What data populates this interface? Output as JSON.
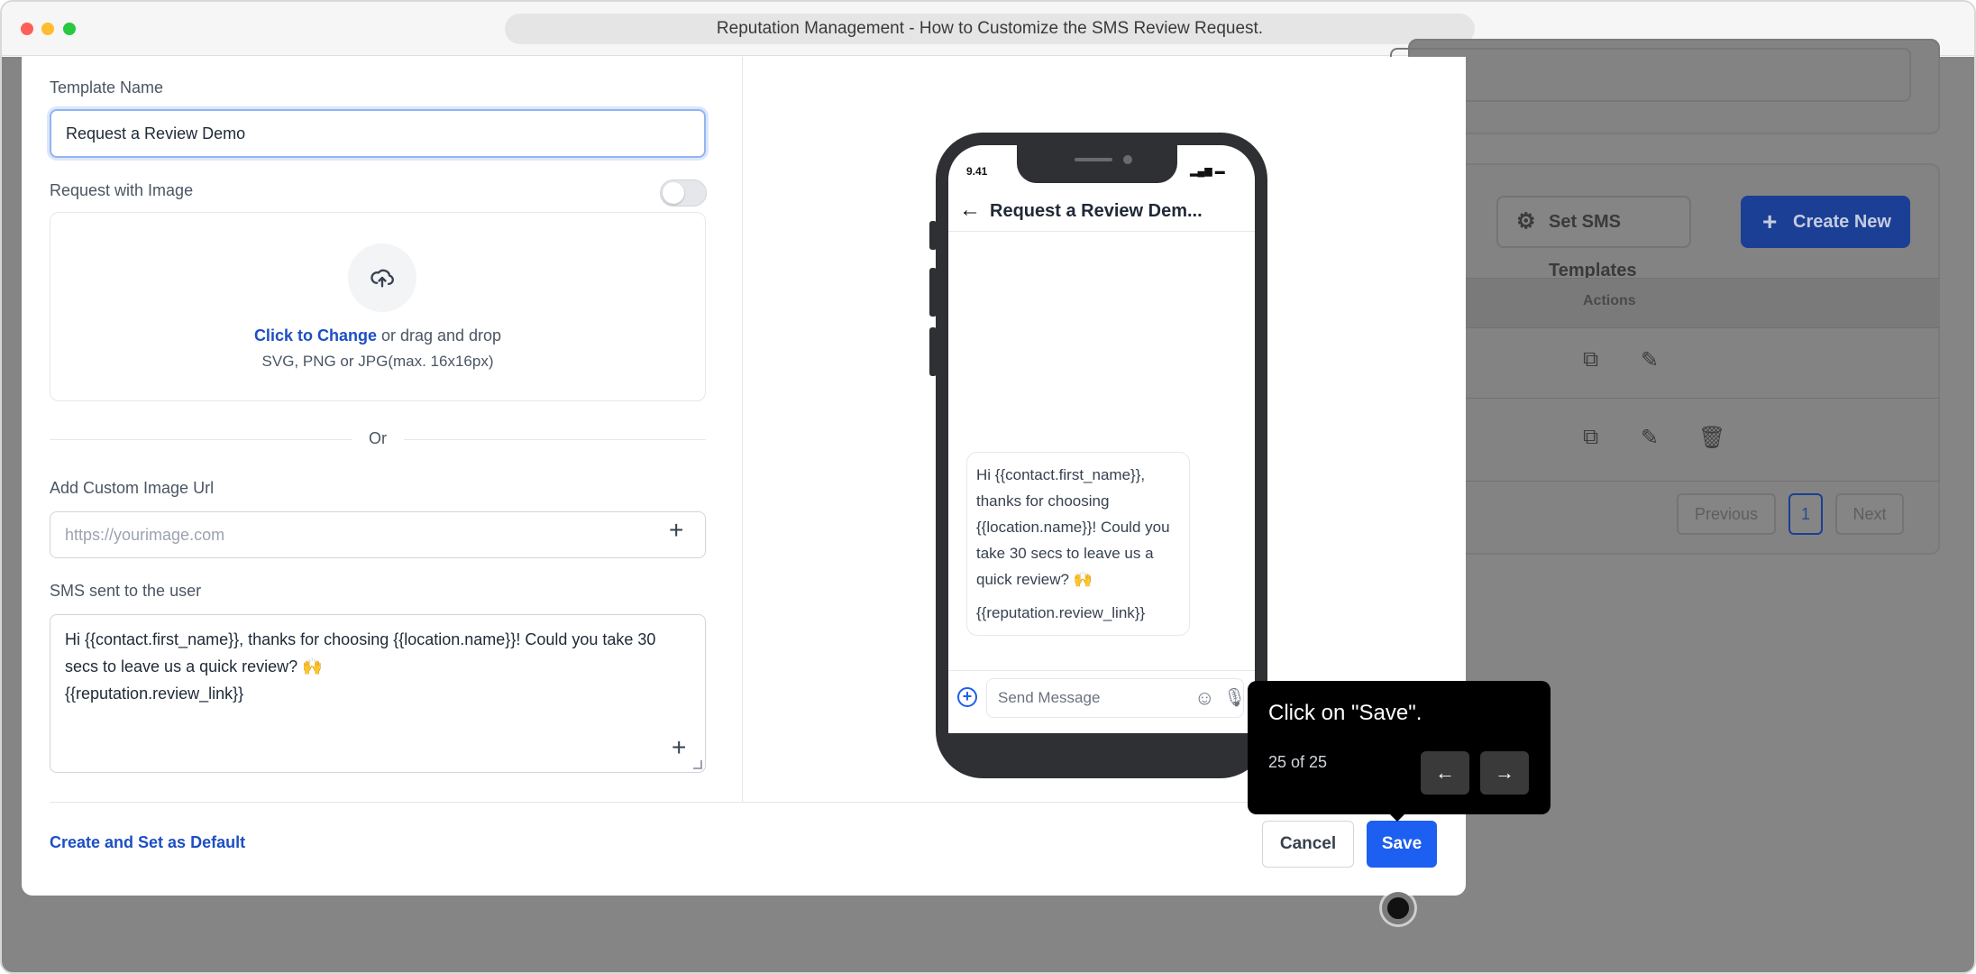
{
  "window": {
    "title": "Reputation Management - How to Customize the SMS Review Request."
  },
  "background": {
    "set_sms_templates": "Set SMS Templates",
    "create_new": "Create New",
    "actions_header": "Actions",
    "pagination": {
      "previous": "Previous",
      "page": "1",
      "next": "Next"
    }
  },
  "form": {
    "template_name_label": "Template Name",
    "template_name_value": "Request a Review Demo",
    "request_with_image_label": "Request with Image",
    "request_with_image_on": false,
    "upload": {
      "link_text": "Click to Change",
      "rest_text": " or drag and drop",
      "hint": "SVG, PNG or JPG(max. 16x16px)"
    },
    "or_text": "Or",
    "custom_image_label": "Add Custom Image Url",
    "custom_image_placeholder": "https://yourimage.com",
    "sms_label": "SMS sent to the user",
    "sms_value": "Hi {{contact.first_name}}, thanks for choosing {{location.name}}! Could you take 30 secs to leave us a quick review? 🙌\n{{reputation.review_link}}"
  },
  "footer": {
    "create_default": "Create and Set as Default",
    "cancel": "Cancel",
    "save": "Save"
  },
  "preview": {
    "time": "9.41",
    "chat_title": "Request a Review Dem...",
    "bubble_text": "Hi {{contact.first_name}}, thanks for choosing {{location.name}}! Could you take 30 secs to leave us a quick review? 🙌",
    "bubble_link": "{{reputation.review_link}}",
    "compose_placeholder": "Send Message"
  },
  "tooltip": {
    "text": "Click on \"Save\".",
    "counter": "25 of 25"
  },
  "icons": {
    "upload": "cloud-upload-icon",
    "gear": "gear-icon",
    "plus": "plus-icon",
    "copy": "copy-icon",
    "edit": "pencil-icon",
    "delete": "trash-icon",
    "back": "arrow-left-icon",
    "prev": "arrow-left-icon",
    "next": "arrow-right-icon"
  },
  "colors": {
    "primary": "#1d5ff0",
    "link": "#1d4fc4",
    "tooltip_bg": "#000000"
  }
}
